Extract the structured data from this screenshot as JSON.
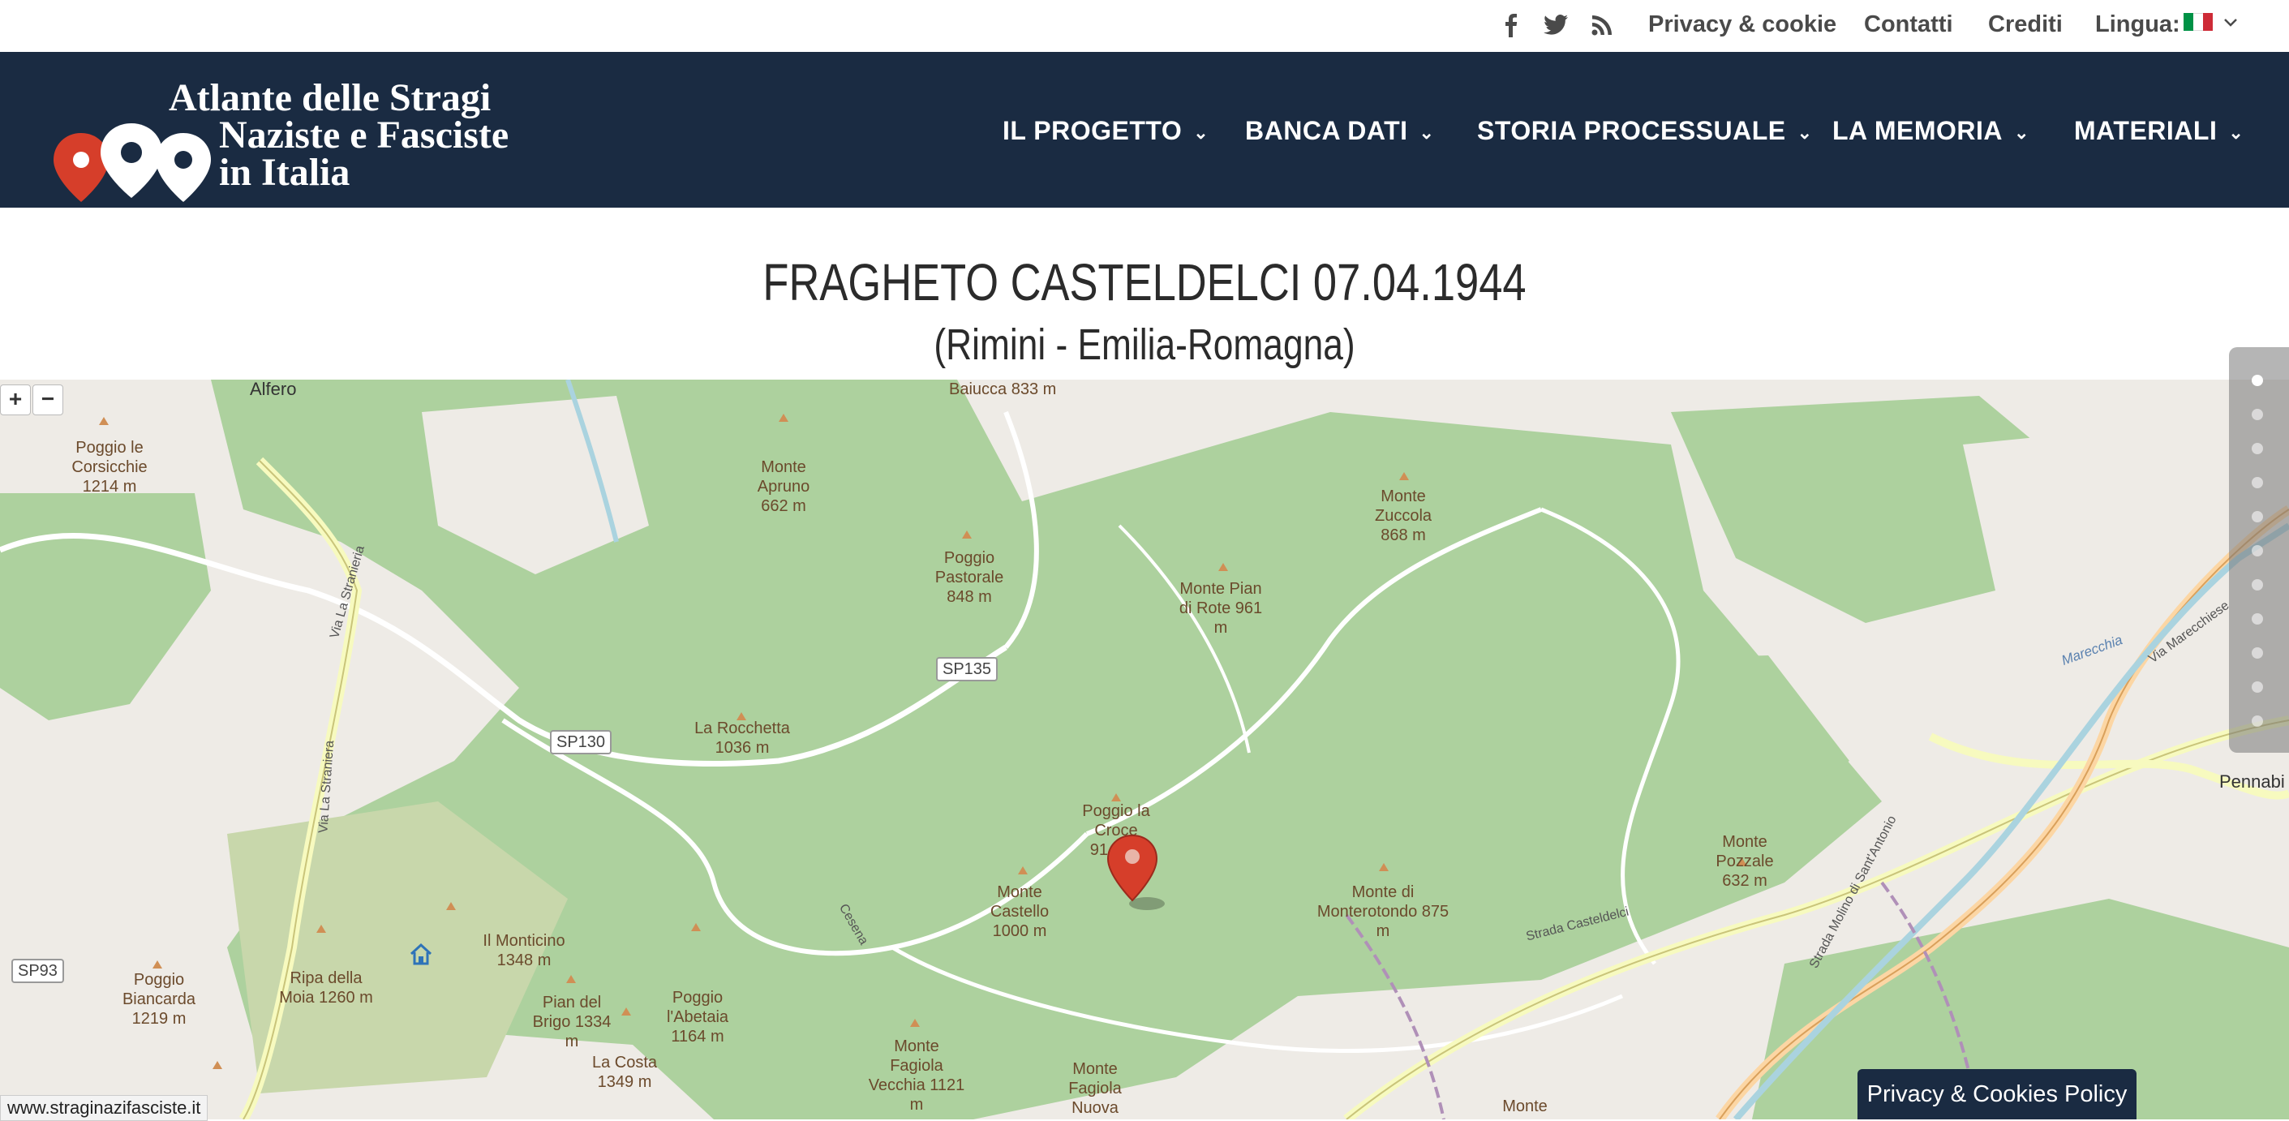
{
  "topbar": {
    "social": [
      "facebook-icon",
      "twitter-icon",
      "rss-icon"
    ],
    "links": [
      "Privacy & cookie",
      "Contatti",
      "Crediti"
    ],
    "language_label": "Lingua:"
  },
  "brand": {
    "line1": "Atlante delle Stragi",
    "line2": "Naziste e Fasciste",
    "line3": "in Italia"
  },
  "menu": [
    "IL PROGETTO",
    "BANCA DATI",
    "STORIA PROCESSUALE",
    "LA MEMORIA",
    "MATERIALI"
  ],
  "page": {
    "title": "FRAGHETO CASTELDELCI 07.04.1944",
    "subtitle": "(Rimini - Emilia-Romagna)"
  },
  "map": {
    "zoom_in": "+",
    "zoom_out": "−",
    "peaks": [
      "Poggio le Corsicchie 1214 m",
      "Monte Aprunо 662 m",
      "Poggio Pastorale 848 m",
      "Monte Pian di Rote 961 m",
      "Monte Zuccola 868 m",
      "La Rocchetta 1036 m",
      "Poggio la Croce 91… m",
      "Monte Castello 1000 m",
      "Monte di Monterotondo 875 m",
      "Monte Pozzale 632 m",
      "Poggio Biancarda 1219 m",
      "Ripa della Moia 1260 m",
      "Il Monticino 1348 m",
      "Pian del Brigo 1334 m",
      "Poggio l'Abetaia 1164 m",
      "La Costa 1349 m",
      "Monte Fagiola Vecchia 1121 m",
      "Monte Fagiola Nuova",
      "Monte"
    ],
    "places": [
      "Alfero",
      "Baiucca 833 m",
      "Pennabi",
      "Strada Casteldelci",
      "Strada Molino di Sant'Antonio",
      "Via Marecchiese",
      "Marecchia",
      "Via La Stranieria",
      "Via La Straniera",
      "Cesena"
    ],
    "roads": [
      "SP135",
      "SP130",
      "SP93"
    ]
  },
  "cookie_button": "Privacy & Cookies Policy",
  "status_url": "www.straginazifasciste.it",
  "colors": {
    "nav_bg": "#1a2b42",
    "forest": "#add19e",
    "marker": "#d63e2a"
  }
}
